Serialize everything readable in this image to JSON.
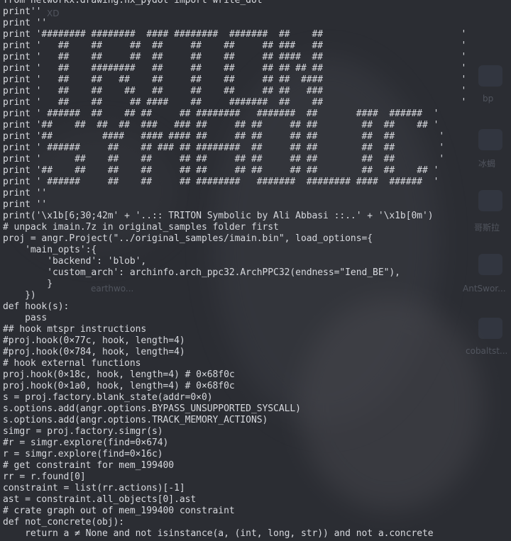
{
  "desktop": {
    "icons": [
      {
        "label": "bp"
      },
      {
        "label": "冰蝎"
      },
      {
        "label": "哥斯拉"
      },
      {
        "label": "AntSwor..."
      },
      {
        "label": "cobaltst..."
      },
      {
        "label": "XD"
      },
      {
        "label": "earthwo..."
      }
    ]
  },
  "terminal": {
    "lines": [
      "from networkx.drawing.nx_pydot import write_dot",
      "print''",
      "print ''",
      "print '######## ########  #### ########  #######  ##    ##                         '",
      "print '   ##    ##     ##  ##     ##    ##     ## ###   ##                         '",
      "print '   ##    ##     ##  ##     ##    ##     ## ####  ##                         '",
      "print '   ##    ########   ##     ##    ##     ## ## ## ##                         '",
      "print '   ##    ##   ##    ##     ##    ##     ## ##  ####                         '",
      "print '   ##    ##    ##   ##     ##    ##     ## ##   ###                         '",
      "print '   ##    ##     ## ####    ##     #######  ##    ##                         '",
      "print ' ######  ##    ## ##     ## ########   #######  ##       ####  ######  '",
      "print '##    ##  ##  ##  ###   ### ##     ## ##     ## ##        ##  ##    ## '",
      "print '##         ####   #### #### ##     ## ##     ## ##        ##  ##        '",
      "print ' ######     ##    ## ### ## ########  ##     ## ##        ##  ##        '",
      "print '      ##    ##    ##     ## ##     ## ##     ## ##        ##  ##        '",
      "print '##    ##    ##    ##     ## ##     ## ##     ## ##        ##  ##    ## '",
      "print ' ######     ##    ##     ## ########   #######  ######## ####  ######  '",
      "print ''",
      "print ''",
      "print('\\x1b[6;30;42m' + '..:: TRITON Symbolic by Ali Abbasi ::..' + '\\x1b[0m')",
      "# unpack imain.7z in original_samples folder first",
      "proj = angr.Project(\"../original_samples/imain.bin\", load_options={",
      "    'main_opts':{",
      "        'backend': 'blob',",
      "        'custom_arch': archinfo.arch_ppc32.ArchPPC32(endness=\"Iend_BE\"),",
      "        }",
      "    })",
      "def hook(s):",
      "    pass",
      "## hook mtspr instructions",
      "#proj.hook(0×77c, hook, length=4)",
      "#proj.hook(0×784, hook, length=4)",
      "# hook external functions",
      "proj.hook(0×18c, hook, length=4) # 0×68f0c",
      "proj.hook(0×1a0, hook, length=4) # 0×68f0c",
      "s = proj.factory.blank_state(addr=0×0)",
      "s.options.add(angr.options.BYPASS_UNSUPPORTED_SYSCALL)",
      "s.options.add(angr.options.TRACK_MEMORY_ACTIONS)",
      "simgr = proj.factory.simgr(s)",
      "#r = simgr.explore(find=0×674)",
      "r = simgr.explore(find=0×16c)",
      "# get constraint for mem_199400",
      "rr = r.found[0]",
      "constraint = list(rr.actions)[-1]",
      "ast = constraint.all_objects[0].ast",
      "# crate graph out of mem_199400 constraint",
      "def not_concrete(obj):",
      "    return a ≠ None and not isinstance(a, (int, long, str)) and not a.concrete"
    ]
  }
}
